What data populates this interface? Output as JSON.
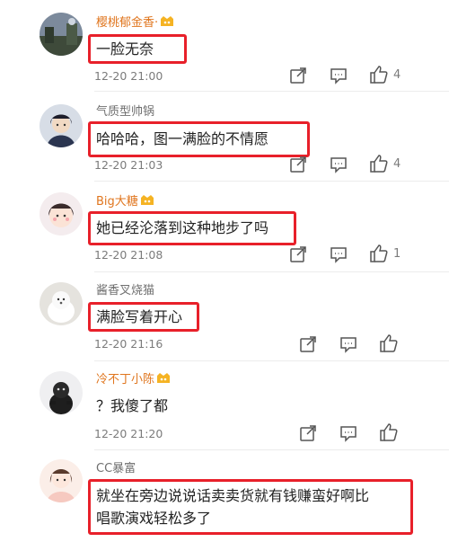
{
  "comments": [
    {
      "username": "樱桃郁金香·",
      "text": "一脸无奈",
      "time": "12-20 21:00",
      "likes": "4"
    },
    {
      "username": "气质型帅锅",
      "text": "哈哈哈，图一满脸的不情愿",
      "time": "12-20 21:03",
      "likes": "4"
    },
    {
      "username": "Big大糖",
      "text": "她已经沦落到这种地步了吗",
      "time": "12-20 21:08",
      "likes": "1"
    },
    {
      "username": "酱香叉烧猫",
      "text": "满脸写着开心",
      "time": "12-20 21:16",
      "likes": ""
    },
    {
      "username": "冷不丁小陈",
      "text": "？我傻了都",
      "time": "12-20 21:20",
      "likes": ""
    },
    {
      "username": "CC暴富",
      "text_line1": "就坐在旁边说说话卖卖货就有钱赚蛮好啊比",
      "text_line2": "唱歌演戏轻松多了"
    }
  ],
  "colors": {
    "username_vip": "#e0761f",
    "username_normal": "#6f6f6f",
    "highlight_box": "#e8202a",
    "meta_text": "#7b7b7b"
  },
  "icons": {
    "share": "share-icon",
    "comment": "comment-icon",
    "like": "like-icon",
    "vip_badge": "vip-badge-icon"
  }
}
